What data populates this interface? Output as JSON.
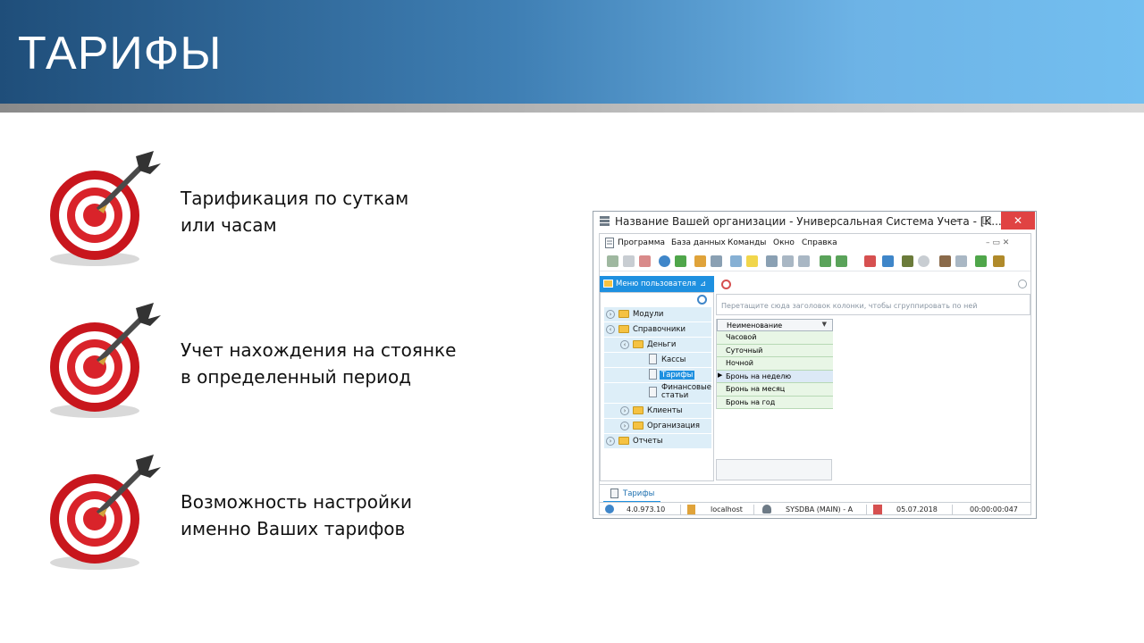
{
  "slide": {
    "title": "ТАРИФЫ"
  },
  "features": [
    {
      "line1": "Тарификация по суткам",
      "line2": "или часам"
    },
    {
      "line1": "Учет нахождения на стоянке",
      "line2": "в определенный период"
    },
    {
      "line1": "Возможность настройки",
      "line2": "именно Ваших тарифов"
    }
  ],
  "window": {
    "title": "Название Вашей организации - Универсальная Система Учета - [K...",
    "minimize": "–",
    "maximize": "☐",
    "close": "✕",
    "menu": [
      "Программа",
      "База данных",
      "Команды",
      "Окно",
      "Справка"
    ],
    "mdi_controls": "– ▭ ✕",
    "sidebar_header": "Меню пользователя",
    "pin": "⊿",
    "tree": [
      {
        "label": "Модули"
      },
      {
        "label": "Справочники"
      },
      {
        "label": "Деньги"
      },
      {
        "label": "Кассы"
      },
      {
        "label": "Тарифы"
      },
      {
        "label": "Финансовые статьи"
      },
      {
        "label": "Клиенты"
      },
      {
        "label": "Организация"
      },
      {
        "label": "Отчеты"
      }
    ],
    "drop_hint": "Перетащите сюда заголовок колонки, чтобы сгруппировать по ней",
    "grid": {
      "column": "Неименование",
      "rows": [
        "Часовой",
        "Суточный",
        "Ночной",
        "Бронь на неделю",
        "Бронь на месяц",
        "Бронь на год"
      ]
    },
    "tab": "Тарифы",
    "status": {
      "version": "4.0.973.10",
      "server": "localhost",
      "user": "SYSDBA (MAIN) - A",
      "date": "05.07.2018",
      "time": "00:00:00:047"
    }
  },
  "colors": {
    "accent": "#1e90e0",
    "header_dark": "#1f4e7a",
    "header_light": "#73bff0",
    "grid_row": "#e8f6e6"
  }
}
